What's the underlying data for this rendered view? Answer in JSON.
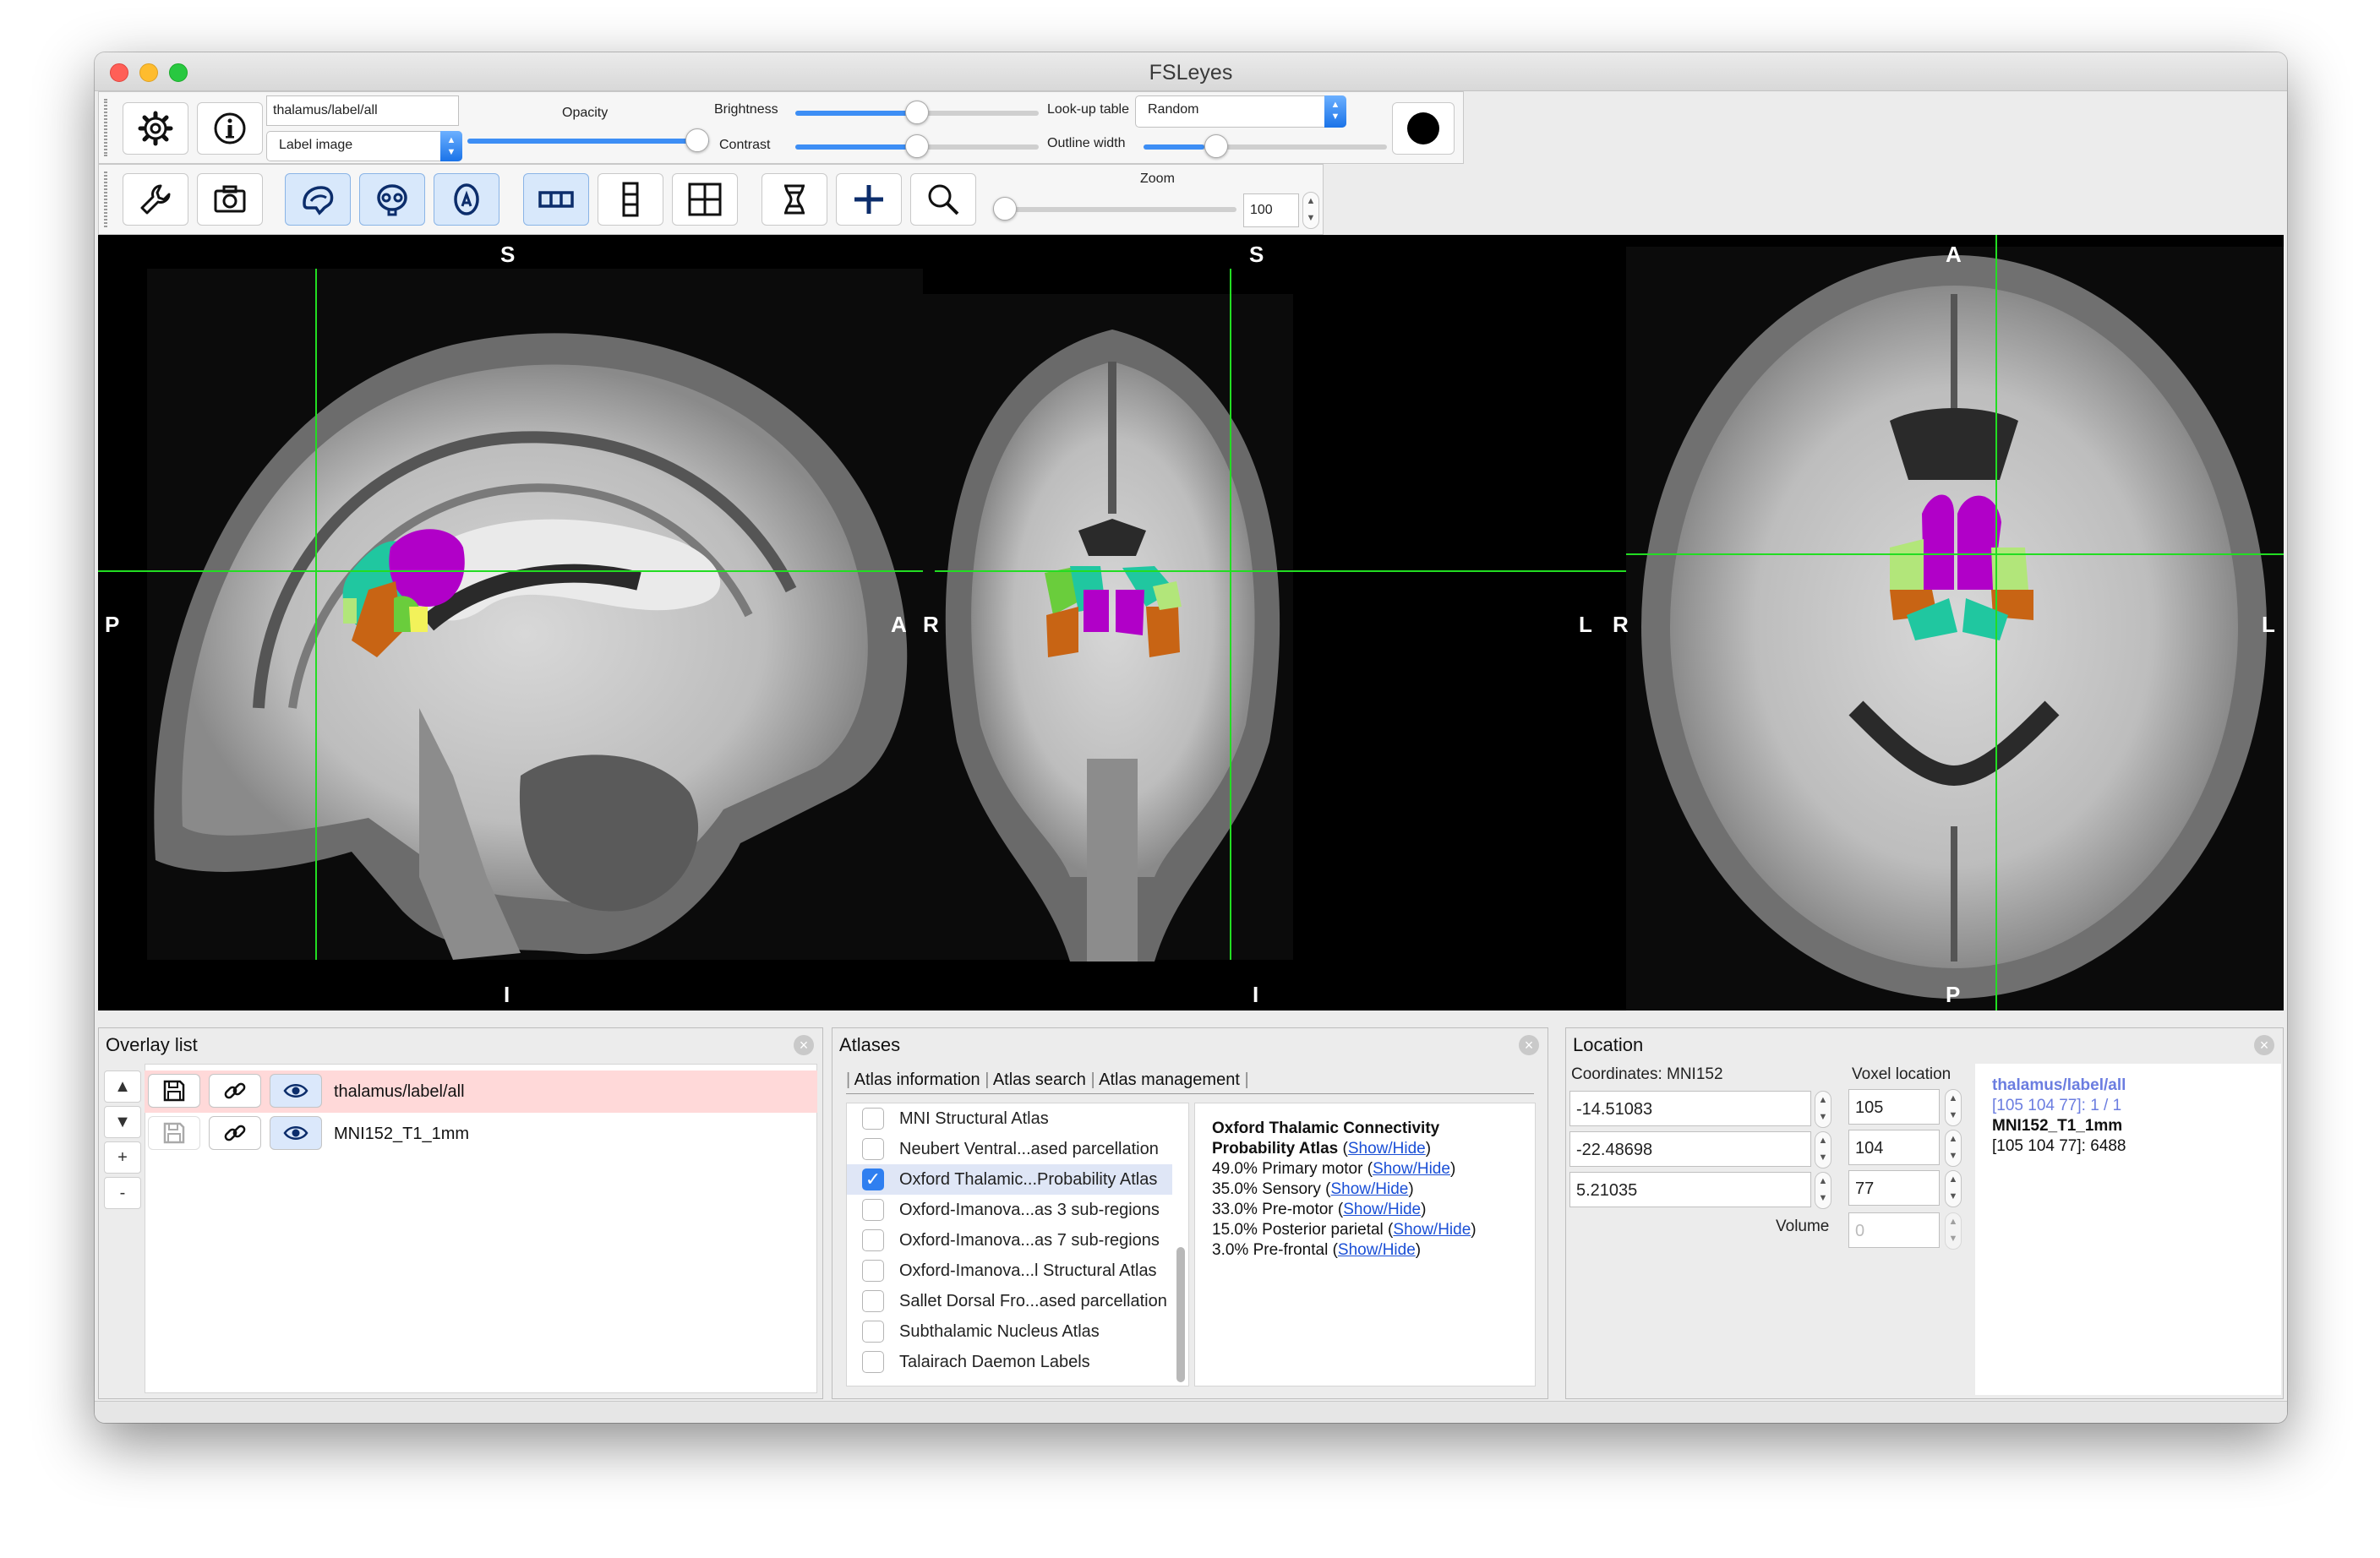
{
  "window": {
    "title": "FSLeyes"
  },
  "overlay_toolbar": {
    "overlay_name": "thalamus/label/all",
    "overlay_type": "Label image",
    "opacity_label": "Opacity",
    "opacity_value": 1.0,
    "brightness_label": "Brightness",
    "brightness_value": 0.5,
    "contrast_label": "Contrast",
    "contrast_value": 0.5,
    "lut_label": "Look-up table",
    "lut_value": "Random",
    "outline_width_label": "Outline width",
    "outline_width_value": 0.25,
    "buttons": [
      "settings-icon",
      "info-icon",
      "color-swatch"
    ]
  },
  "ortho_toolbar": {
    "buttons": [
      "wrench-icon",
      "camera-icon",
      "sagittal-view-icon",
      "coronal-view-icon",
      "axial-view-icon",
      "horizontal-layout-icon",
      "vertical-layout-icon",
      "grid-layout-icon",
      "movie-icon",
      "cursor-icon",
      "zoom-icon"
    ],
    "zoom_label": "Zoom",
    "zoom_value": "100",
    "zoom_slider": 0.0
  },
  "viewer": {
    "sagittal": {
      "top": "S",
      "bottom": "I",
      "left": "P",
      "right": "A"
    },
    "coronal": {
      "top": "S",
      "bottom": "I",
      "left": "R",
      "right": "L"
    },
    "axial": {
      "top": "A",
      "bottom": "P",
      "left": "R",
      "right": "L"
    },
    "crosshair_color": "#22dd22",
    "label_colors": [
      "#b100c8",
      "#20c7a0",
      "#c86414",
      "#6acd3c",
      "#b2e67a",
      "#f2f25a"
    ]
  },
  "overlay_list": {
    "title": "Overlay list",
    "items": [
      {
        "name": "thalamus/label/all",
        "selected": true
      },
      {
        "name": "MNI152_T1_1mm",
        "selected": false
      }
    ],
    "side_buttons": [
      "▲",
      "▼",
      "+",
      "-"
    ]
  },
  "atlases": {
    "title": "Atlases",
    "tabs": [
      "Atlas information",
      "Atlas search",
      "Atlas management"
    ],
    "list": [
      {
        "name": "MNI Structural Atlas",
        "checked": false
      },
      {
        "name": "Neubert Ventral...ased parcellation",
        "checked": false
      },
      {
        "name": "Oxford Thalamic...Probability Atlas",
        "checked": true
      },
      {
        "name": "Oxford-Imanova...as 3 sub-regions",
        "checked": false
      },
      {
        "name": "Oxford-Imanova...as 7 sub-regions",
        "checked": false
      },
      {
        "name": "Oxford-Imanova...l Structural Atlas",
        "checked": false
      },
      {
        "name": "Sallet Dorsal Fro...ased parcellation",
        "checked": false
      },
      {
        "name": "Subthalamic Nucleus Atlas",
        "checked": false
      },
      {
        "name": "Talairach Daemon Labels",
        "checked": false
      }
    ],
    "info": {
      "title_line1": "Oxford Thalamic Connectivity",
      "title_line2": "Probability Atlas",
      "show_hide": "Show/Hide",
      "entries": [
        "49.0% Primary motor",
        "35.0% Sensory",
        "33.0% Pre-motor",
        "15.0% Posterior parietal",
        "3.0% Pre-frontal"
      ]
    }
  },
  "location": {
    "title": "Location",
    "coords_label": "Coordinates: MNI152",
    "voxel_label": "Voxel location",
    "coords": [
      "-14.51083",
      "-22.48698",
      "5.21035"
    ],
    "voxels": [
      "105",
      "104",
      "77"
    ],
    "volume_label": "Volume",
    "volume_value": "0",
    "info": {
      "overlay1": "thalamus/label/all",
      "overlay1_value": "[105 104 77]: 1 / 1",
      "overlay2": "MNI152_T1_1mm",
      "overlay2_value": "[105 104 77]: 6488"
    }
  }
}
